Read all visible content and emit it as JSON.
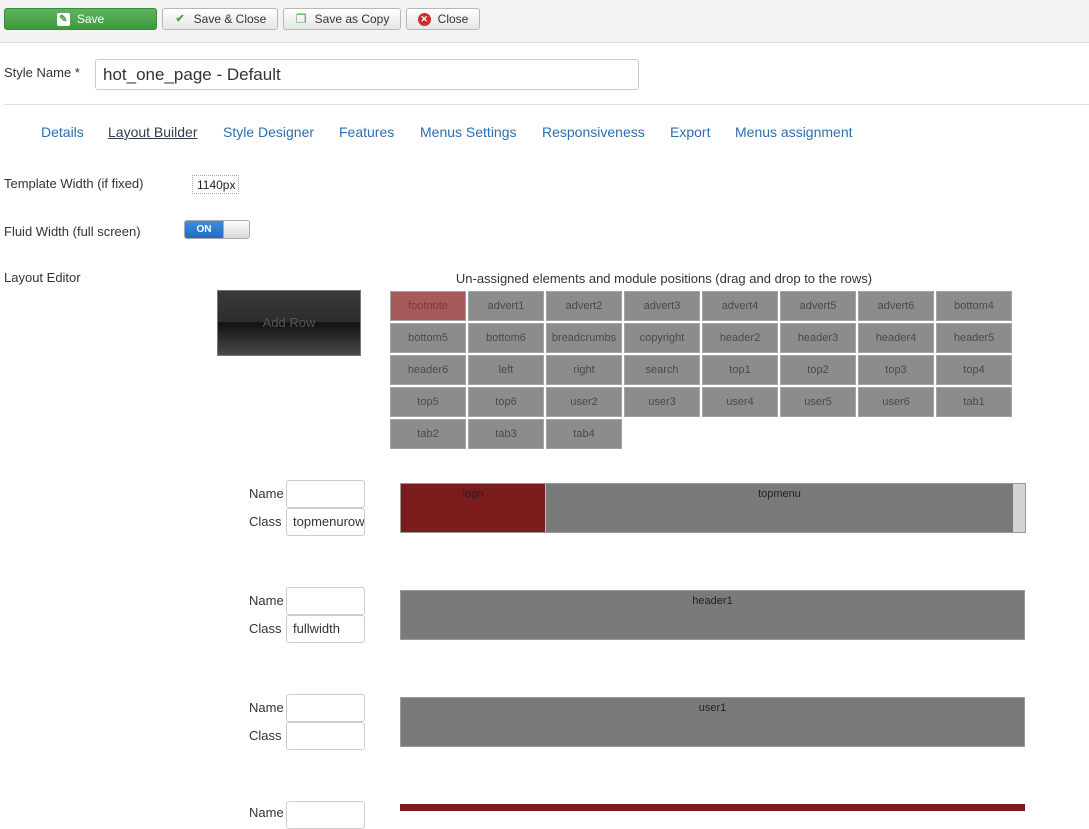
{
  "toolbar": {
    "save": "Save",
    "save_close": "Save & Close",
    "save_copy": "Save as Copy",
    "close": "Close"
  },
  "style": {
    "label": "Style Name *",
    "value": "hot_one_page - Default"
  },
  "tabs": [
    {
      "label": "Details"
    },
    {
      "label": "Layout Builder",
      "active": true
    },
    {
      "label": "Style Designer"
    },
    {
      "label": "Features"
    },
    {
      "label": "Menus Settings"
    },
    {
      "label": "Responsiveness"
    },
    {
      "label": "Export"
    },
    {
      "label": "Menus assignment"
    }
  ],
  "settings": {
    "template_width_label": "Template Width (if fixed)",
    "template_width_value": "1140px",
    "fluid_width_label": "Fluid Width (full screen)",
    "fluid_toggle": "ON",
    "layout_editor_label": "Layout Editor"
  },
  "layout": {
    "add_row": "Add Row",
    "unassigned_title": "Un-assigned elements and module positions (drag and drop to the rows)",
    "positions": [
      "footnote",
      "advert1",
      "advert2",
      "advert3",
      "advert4",
      "advert5",
      "advert6",
      "bottom4",
      "bottom5",
      "bottom6",
      "breadcrumbs",
      "copyright",
      "header2",
      "header3",
      "header4",
      "header5",
      "header6",
      "left",
      "right",
      "search",
      "top1",
      "top2",
      "top3",
      "top4",
      "top5",
      "top6",
      "user2",
      "user3",
      "user4",
      "user5",
      "user6",
      "tab1",
      "tab2",
      "tab3",
      "tab4"
    ]
  },
  "rows": [
    {
      "name_label": "Name",
      "class_label": "Class",
      "name": "",
      "class": "topmenurow",
      "blocks": [
        "logo",
        "topmenu"
      ]
    },
    {
      "name_label": "Name",
      "class_label": "Class",
      "name": "",
      "class": "fullwidth",
      "blocks": [
        "header1"
      ]
    },
    {
      "name_label": "Name",
      "class_label": "Class",
      "name": "",
      "class": "",
      "blocks": [
        "user1"
      ]
    },
    {
      "name_label": "Name"
    }
  ],
  "colors": {
    "save_green": "#46a546",
    "link_blue": "#2a6fb0",
    "block_dark_red": "#7a1c1c",
    "block_grey": "#7a7a7a"
  }
}
